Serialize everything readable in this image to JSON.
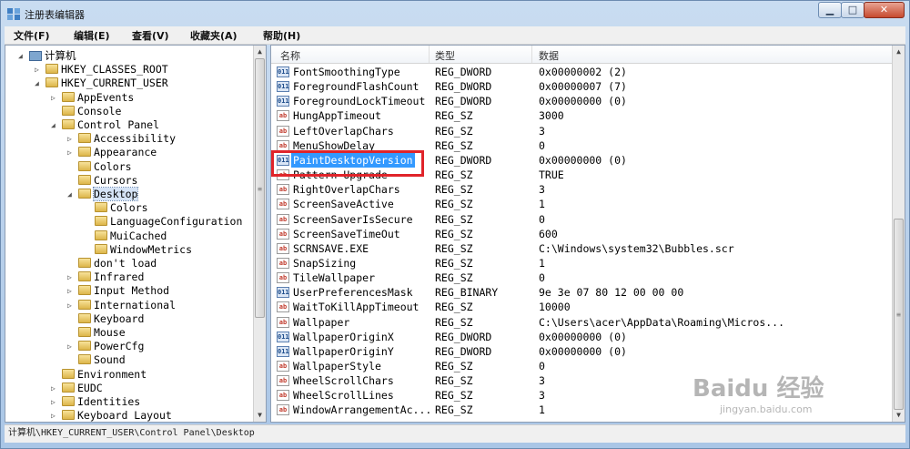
{
  "window": {
    "title": "注册表编辑器"
  },
  "window_buttons": {
    "minimize": "▁",
    "maximize": "□",
    "close": "✕"
  },
  "menu": [
    "文件(F)",
    "编辑(E)",
    "查看(V)",
    "收藏夹(A)",
    "帮助(H)"
  ],
  "tree": [
    {
      "label": "计算机",
      "level": 0,
      "expander": "◢",
      "type": "computer"
    },
    {
      "label": "HKEY_CLASSES_ROOT",
      "level": 1,
      "expander": "▷",
      "type": "folder"
    },
    {
      "label": "HKEY_CURRENT_USER",
      "level": 1,
      "expander": "◢",
      "type": "folder"
    },
    {
      "label": "AppEvents",
      "level": 2,
      "expander": "▷",
      "type": "folder"
    },
    {
      "label": "Console",
      "level": 2,
      "expander": "",
      "type": "folder"
    },
    {
      "label": "Control Panel",
      "level": 2,
      "expander": "◢",
      "type": "folder"
    },
    {
      "label": "Accessibility",
      "level": 3,
      "expander": "▷",
      "type": "folder"
    },
    {
      "label": "Appearance",
      "level": 3,
      "expander": "▷",
      "type": "folder"
    },
    {
      "label": "Colors",
      "level": 3,
      "expander": "",
      "type": "folder"
    },
    {
      "label": "Cursors",
      "level": 3,
      "expander": "",
      "type": "folder"
    },
    {
      "label": "Desktop",
      "level": 3,
      "expander": "◢",
      "type": "folder",
      "selected": true
    },
    {
      "label": "Colors",
      "level": 4,
      "expander": "",
      "type": "folder"
    },
    {
      "label": "LanguageConfiguration",
      "level": 4,
      "expander": "",
      "type": "folder"
    },
    {
      "label": "MuiCached",
      "level": 4,
      "expander": "",
      "type": "folder"
    },
    {
      "label": "WindowMetrics",
      "level": 4,
      "expander": "",
      "type": "folder"
    },
    {
      "label": "don't load",
      "level": 3,
      "expander": "",
      "type": "folder"
    },
    {
      "label": "Infrared",
      "level": 3,
      "expander": "▷",
      "type": "folder"
    },
    {
      "label": "Input Method",
      "level": 3,
      "expander": "▷",
      "type": "folder"
    },
    {
      "label": "International",
      "level": 3,
      "expander": "▷",
      "type": "folder"
    },
    {
      "label": "Keyboard",
      "level": 3,
      "expander": "",
      "type": "folder"
    },
    {
      "label": "Mouse",
      "level": 3,
      "expander": "",
      "type": "folder"
    },
    {
      "label": "PowerCfg",
      "level": 3,
      "expander": "▷",
      "type": "folder"
    },
    {
      "label": "Sound",
      "level": 3,
      "expander": "",
      "type": "folder"
    },
    {
      "label": "Environment",
      "level": 2,
      "expander": "",
      "type": "folder"
    },
    {
      "label": "EUDC",
      "level": 2,
      "expander": "▷",
      "type": "folder"
    },
    {
      "label": "Identities",
      "level": 2,
      "expander": "▷",
      "type": "folder"
    },
    {
      "label": "Keyboard Layout",
      "level": 2,
      "expander": "▷",
      "type": "folder"
    }
  ],
  "columns": [
    "名称",
    "类型",
    "数据"
  ],
  "values": [
    {
      "name": "FontSmoothingType",
      "type": "REG_DWORD",
      "data": "0x00000002 (2)",
      "icon": "bin"
    },
    {
      "name": "ForegroundFlashCount",
      "type": "REG_DWORD",
      "data": "0x00000007 (7)",
      "icon": "bin"
    },
    {
      "name": "ForegroundLockTimeout",
      "type": "REG_DWORD",
      "data": "0x00000000 (0)",
      "icon": "bin"
    },
    {
      "name": "HungAppTimeout",
      "type": "REG_SZ",
      "data": "3000",
      "icon": "sz"
    },
    {
      "name": "LeftOverlapChars",
      "type": "REG_SZ",
      "data": "3",
      "icon": "sz"
    },
    {
      "name": "MenuShowDelay",
      "type": "REG_SZ",
      "data": "0",
      "icon": "sz"
    },
    {
      "name": "PaintDesktopVersion",
      "type": "REG_DWORD",
      "data": "0x00000000 (0)",
      "icon": "bin",
      "selected": true
    },
    {
      "name": "Pattern Upgrade",
      "type": "REG_SZ",
      "data": "TRUE",
      "icon": "sz"
    },
    {
      "name": "RightOverlapChars",
      "type": "REG_SZ",
      "data": "3",
      "icon": "sz"
    },
    {
      "name": "ScreenSaveActive",
      "type": "REG_SZ",
      "data": "1",
      "icon": "sz"
    },
    {
      "name": "ScreenSaverIsSecure",
      "type": "REG_SZ",
      "data": "0",
      "icon": "sz"
    },
    {
      "name": "ScreenSaveTimeOut",
      "type": "REG_SZ",
      "data": "600",
      "icon": "sz"
    },
    {
      "name": "SCRNSAVE.EXE",
      "type": "REG_SZ",
      "data": "C:\\Windows\\system32\\Bubbles.scr",
      "icon": "sz"
    },
    {
      "name": "SnapSizing",
      "type": "REG_SZ",
      "data": "1",
      "icon": "sz"
    },
    {
      "name": "TileWallpaper",
      "type": "REG_SZ",
      "data": "0",
      "icon": "sz"
    },
    {
      "name": "UserPreferencesMask",
      "type": "REG_BINARY",
      "data": "9e 3e 07 80 12 00 00 00",
      "icon": "bin"
    },
    {
      "name": "WaitToKillAppTimeout",
      "type": "REG_SZ",
      "data": "10000",
      "icon": "sz"
    },
    {
      "name": "Wallpaper",
      "type": "REG_SZ",
      "data": "C:\\Users\\acer\\AppData\\Roaming\\Micros...",
      "icon": "sz"
    },
    {
      "name": "WallpaperOriginX",
      "type": "REG_DWORD",
      "data": "0x00000000 (0)",
      "icon": "bin"
    },
    {
      "name": "WallpaperOriginY",
      "type": "REG_DWORD",
      "data": "0x00000000 (0)",
      "icon": "bin"
    },
    {
      "name": "WallpaperStyle",
      "type": "REG_SZ",
      "data": "0",
      "icon": "sz"
    },
    {
      "name": "WheelScrollChars",
      "type": "REG_SZ",
      "data": "3",
      "icon": "sz"
    },
    {
      "name": "WheelScrollLines",
      "type": "REG_SZ",
      "data": "3",
      "icon": "sz"
    },
    {
      "name": "WindowArrangementAc...",
      "type": "REG_SZ",
      "data": "1",
      "icon": "sz"
    }
  ],
  "icon_labels": {
    "sz": "ab",
    "bin": "011"
  },
  "status": "计算机\\HKEY_CURRENT_USER\\Control Panel\\Desktop",
  "watermark": {
    "brand": "Baidu 经验",
    "url": "jingyan.baidu.com"
  },
  "colors": {
    "selection": "#3399ff",
    "highlight_box": "#e0242a"
  }
}
